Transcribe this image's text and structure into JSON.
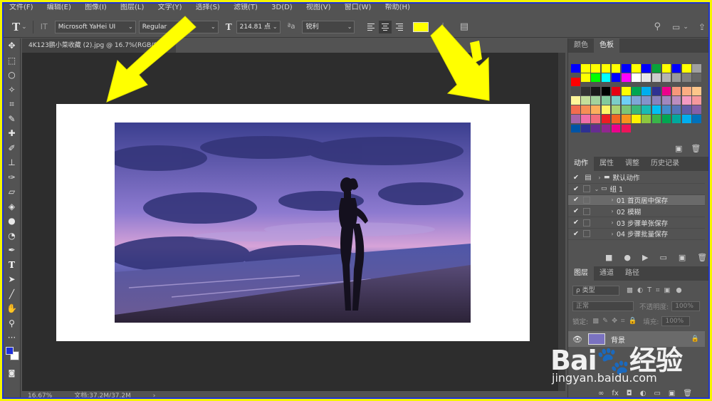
{
  "menu": [
    "文件(F)",
    "编辑(E)",
    "图像(I)",
    "图层(L)",
    "文字(Y)",
    "选择(S)",
    "滤镜(T)",
    "3D(D)",
    "视图(V)",
    "窗口(W)",
    "帮助(H)"
  ],
  "options": {
    "tool_glyph": "T",
    "orient_glyph": "IT",
    "font_family": "Microsoft YaHei UI",
    "font_style": "Regular",
    "size_glyph": "T",
    "font_size": "214.81 点",
    "aa_glyph": "ªa",
    "antialias": "锐利",
    "text_color": "#ffff00"
  },
  "document": {
    "tab_title": "4K123鹏小菜收藏 (2).jpg @ 16.7%(RGB/8)",
    "close": "×",
    "zoom": "16.67%",
    "doc_info": "文档:37.2M/37.2M",
    "status_arrow": "›"
  },
  "swatch_panel": {
    "tabs": [
      "颜色",
      "色板"
    ],
    "active": "色板",
    "colors": [
      "#0000ff",
      "#ffff00",
      "#ffff00",
      "#ffff00",
      "#ffff00",
      "#0000ff",
      "#ffff00",
      "#0000ff",
      "#0aa23a",
      "#ffff00",
      "#0000ff",
      "#ffff00",
      "#a0a0a0",
      "#ff0000",
      "#ffff00",
      "#00ff00",
      "#00ffff",
      "#0000ff",
      "#ff00ff",
      "#ffffff",
      "#e6e6e6",
      "#cccccc",
      "#b3b3b3",
      "#999999",
      "#808080",
      "#666666",
      "#4d4d4d",
      "#333333",
      "#1a1a1a",
      "#000000",
      "#e60012",
      "#ffff00",
      "#00a651",
      "#00aeef",
      "#2e3192",
      "#ec008c",
      "#f7977a",
      "#fbad82",
      "#fdc68a",
      "#fff79a",
      "#c4df9b",
      "#a2d39c",
      "#82ca9d",
      "#7bcdc8",
      "#6ecff6",
      "#7ea7d8",
      "#8493ca",
      "#8882be",
      "#a187be",
      "#bc8dbf",
      "#f49ac2",
      "#f6989d",
      "#f26c4f",
      "#f68e55",
      "#fbaf5c",
      "#fff467",
      "#acd372",
      "#7cc576",
      "#3bb878",
      "#1abbb4",
      "#00bff3",
      "#438ccb",
      "#5574b9",
      "#605ca8",
      "#855fa8",
      "#a763a8",
      "#f06ea9",
      "#f26d7d",
      "#ed1c24",
      "#f26522",
      "#f7941d",
      "#fff200",
      "#8dc73f",
      "#39b54a",
      "#00a651",
      "#00a99d",
      "#00aeef",
      "#0072bc",
      "#0054a6",
      "#2e3192",
      "#662d91",
      "#92278f",
      "#ec008c",
      "#ed145b"
    ]
  },
  "actions_panel": {
    "tabs": [
      "动作",
      "属性",
      "调整",
      "历史记录"
    ],
    "rows": [
      {
        "label": "默认动作",
        "level": 0,
        "folder": true,
        "open": false,
        "box": "▤"
      },
      {
        "label": "组 1",
        "level": 0,
        "folder": true,
        "open": true,
        "box": ""
      },
      {
        "label": "01 首页居中保存",
        "level": 1,
        "folder": false,
        "open": false,
        "box": ""
      },
      {
        "label": "02 模糊",
        "level": 1,
        "folder": false,
        "open": false,
        "box": ""
      },
      {
        "label": "03 步骤单张保存",
        "level": 1,
        "folder": false,
        "open": false,
        "box": ""
      },
      {
        "label": "04 步骤批量保存",
        "level": 1,
        "folder": false,
        "open": false,
        "box": ""
      }
    ],
    "footer": [
      "■",
      "●",
      "▶",
      "▭",
      "▣",
      "🗑"
    ]
  },
  "layers_panel": {
    "tabs": [
      "图层",
      "通道",
      "路径"
    ],
    "kind": "ρ 类型",
    "blend": "正常",
    "opacity_label": "不透明度:",
    "opacity": "100%",
    "lock_label": "锁定:",
    "fill_label": "填充:",
    "fill": "100%",
    "layer_name": "背景",
    "footer": [
      "∞",
      "fx",
      "◘",
      "◐",
      "▭",
      "▣",
      "🗑"
    ]
  },
  "watermark": {
    "main": "Bai🐾经验",
    "sub": "jingyan.baidu.com"
  },
  "colors": {
    "arrow": "#ffff00",
    "border": "#1d33d8",
    "ps_panel": "#535353",
    "foreground": "#1f2fd9",
    "background": "#ffffff"
  }
}
